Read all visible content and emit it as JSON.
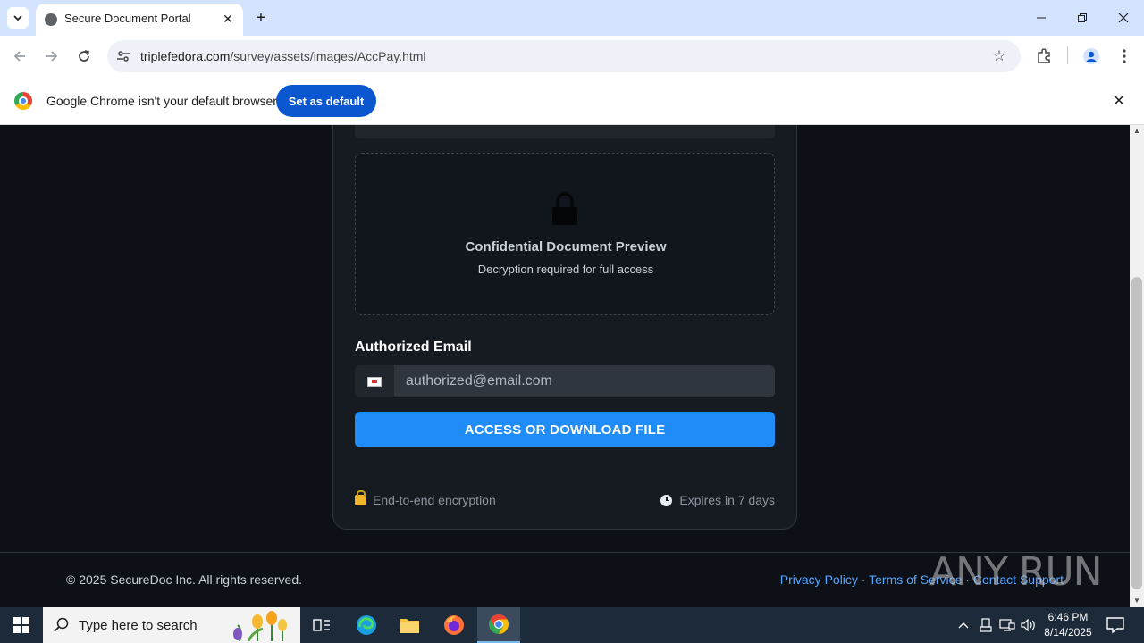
{
  "browser": {
    "tab_title": "Secure Document Portal",
    "url_domain": "triplefedora.com",
    "url_path": "/survey/assets/images/AccPay.html",
    "infobar_text": "Google Chrome isn't your default browser",
    "set_default_label": "Set as default"
  },
  "card": {
    "preview_title": "Confidential Document Preview",
    "preview_subtitle": "Decryption required for full access",
    "email_label": "Authorized Email",
    "email_placeholder": "authorized@email.com",
    "access_button": "ACCESS OR DOWNLOAD FILE",
    "encryption_note": "End-to-end encryption",
    "expiry_note": "Expires in 7 days"
  },
  "footer": {
    "copyright": "© 2025 SecureDoc Inc. All rights reserved.",
    "links": [
      "Privacy Policy",
      "Terms of Service",
      "Contact Support"
    ],
    "separator": " · "
  },
  "watermark": "ANY RUN",
  "taskbar": {
    "search_placeholder": "Type here to search",
    "time": "6:46 PM",
    "date": "8/14/2025"
  },
  "colors": {
    "accent": "#1f8cf8",
    "page_bg": "#0d1117",
    "card_bg": "#161b22",
    "link": "#58a6ff"
  }
}
